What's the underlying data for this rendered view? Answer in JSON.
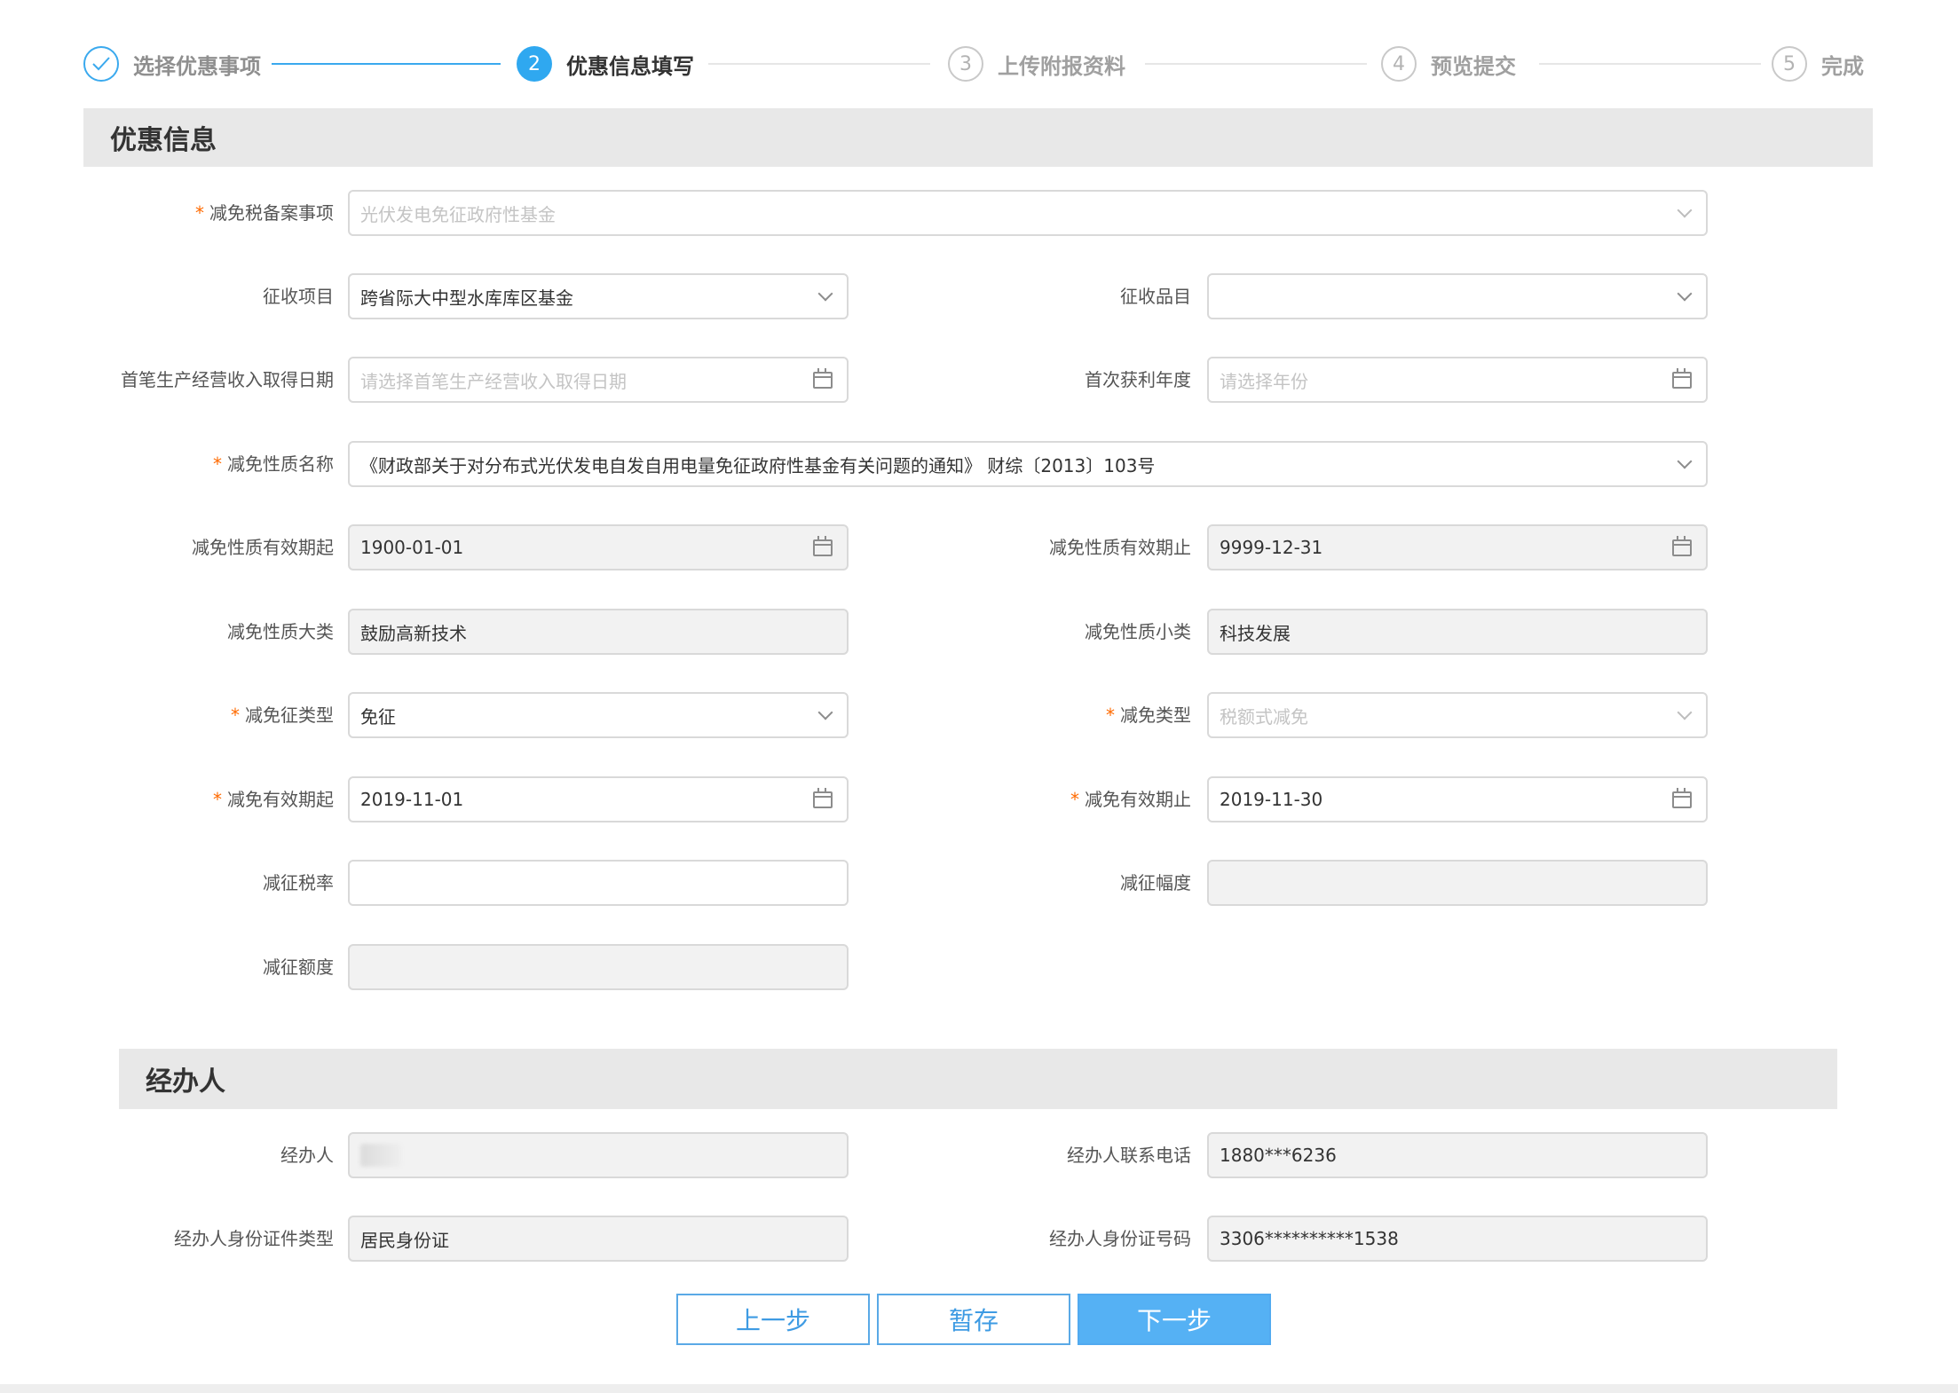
{
  "stepper": {
    "steps": [
      {
        "number": "1",
        "label": "选择优惠事项",
        "state": "done"
      },
      {
        "number": "2",
        "label": "优惠信息填写",
        "state": "active"
      },
      {
        "number": "3",
        "label": "上传附报资料",
        "state": "pending"
      },
      {
        "number": "4",
        "label": "预览提交",
        "state": "pending"
      },
      {
        "number": "5",
        "label": "完成",
        "state": "pending"
      }
    ],
    "check_icon": "check-icon",
    "colors": {
      "active": "#2fa8f0",
      "pending": "#c9c9c9"
    }
  },
  "sections": {
    "discount": {
      "title": "优惠信息"
    },
    "handler": {
      "title": "经办人"
    }
  },
  "form": {
    "filing_item": {
      "label": "减免税备案事项",
      "required": true,
      "value": "",
      "placeholder": "光伏发电免征政府性基金"
    },
    "collection_item": {
      "label": "征收项目",
      "value": "跨省际大中型水库库区基金"
    },
    "collection_subitem": {
      "label": "征收品目",
      "value": ""
    },
    "first_income_date": {
      "label": "首笔生产经营收入取得日期",
      "placeholder": "请选择首笔生产经营收入取得日期"
    },
    "first_profit_year": {
      "label": "首次获利年度",
      "placeholder": "请选择年份"
    },
    "nature_name": {
      "label": "减免性质名称",
      "required": true,
      "value": "《财政部关于对分布式光伏发电自发自用电量免征政府性基金有关问题的通知》 财综〔2013〕103号"
    },
    "nature_valid_from": {
      "label": "减免性质有效期起",
      "value": "1900-01-01"
    },
    "nature_valid_to": {
      "label": "减免性质有效期止",
      "value": "9999-12-31"
    },
    "nature_category": {
      "label": "减免性质大类",
      "value": "鼓励高新技术"
    },
    "nature_subcategory": {
      "label": "减免性质小类",
      "value": "科技发展"
    },
    "reduction_levy_type": {
      "label": "减免征类型",
      "required": true,
      "value": "免征"
    },
    "reduction_type": {
      "label": "减免类型",
      "required": true,
      "placeholder": "税额式减免"
    },
    "valid_from": {
      "label": "减免有效期起",
      "required": true,
      "value": "2019-11-01"
    },
    "valid_to": {
      "label": "减免有效期止",
      "required": true,
      "value": "2019-11-30"
    },
    "levy_rate": {
      "label": "减征税率",
      "value": ""
    },
    "levy_range": {
      "label": "减征幅度",
      "value": ""
    },
    "levy_amount": {
      "label": "减征额度",
      "value": ""
    }
  },
  "handler": {
    "name": {
      "label": "经办人",
      "value": ""
    },
    "phone": {
      "label": "经办人联系电话",
      "value": "1880***6236"
    },
    "id_type": {
      "label": "经办人身份证件类型",
      "value": "居民身份证"
    },
    "id_number": {
      "label": "经办人身份证号码",
      "value": "3306**********1538"
    }
  },
  "buttons": {
    "prev": "上一步",
    "save": "暂存",
    "next": "下一步"
  },
  "icons": {
    "dropdown": "chevron-down-icon",
    "date": "calendar-icon"
  },
  "colors": {
    "required_mark": "#ff6a00",
    "primary_button": "#55b1f4",
    "section_bg": "#e8e8e8",
    "disabled_field": "#f2f2f2"
  }
}
